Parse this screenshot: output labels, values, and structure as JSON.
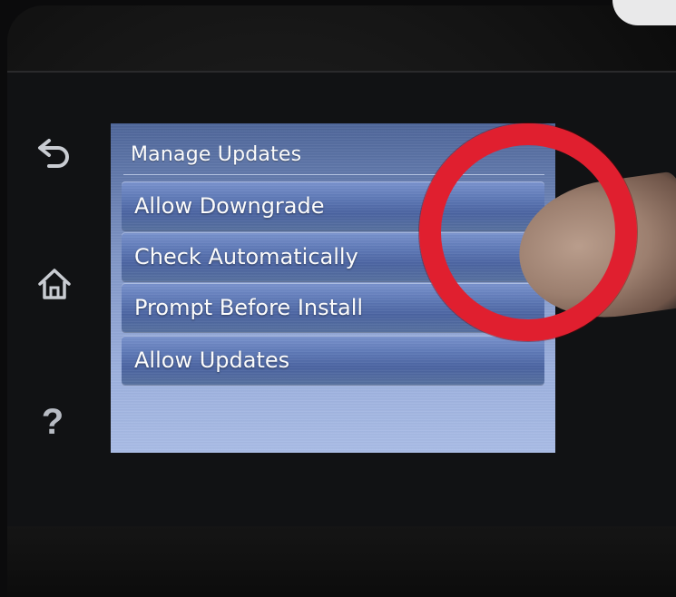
{
  "screen": {
    "title": "Manage Updates",
    "menu_items": [
      {
        "label": "Allow Downgrade"
      },
      {
        "label": "Check Automatically"
      },
      {
        "label": "Prompt Before Install"
      },
      {
        "label": "Allow Updates"
      }
    ]
  },
  "side_controls": {
    "back_icon": "back-arrow-icon",
    "home_icon": "home-icon",
    "help_label": "?"
  },
  "annotation": {
    "color": "#e01f2f"
  }
}
